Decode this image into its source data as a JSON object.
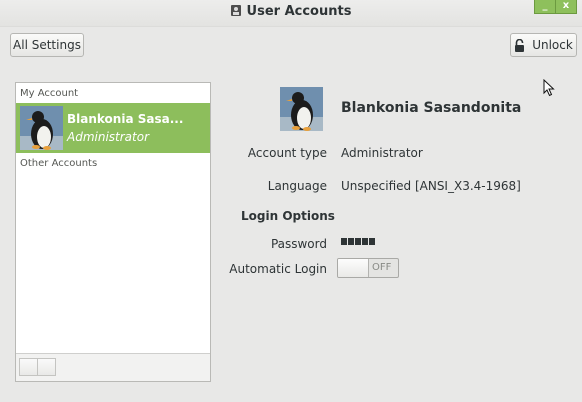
{
  "window": {
    "title": "User Accounts",
    "buttons": [
      "_",
      "x"
    ]
  },
  "toolbar": {
    "all_settings_label": "All Settings",
    "unlock_label": "Unlock"
  },
  "accounts": {
    "my_account_header": "My Account",
    "other_accounts_header": "Other Accounts",
    "selected_account": {
      "name": "Blankonia Sasa...",
      "role": "Administrator"
    }
  },
  "details": {
    "full_name": "Blankonia Sasandonita",
    "account_type_label": "Account type",
    "account_type_value": "Administrator",
    "language_label": "Language",
    "language_value": "Unspecified [ANSI_X3.4-1968]",
    "login_options_header": "Login Options",
    "password_label": "Password",
    "password_value": "●●●●●",
    "automatic_login_label": "Automatic Login",
    "automatic_login_state": "OFF"
  },
  "colors": {
    "selection": "#8dbe5c",
    "window_bg": "#e8e8e7",
    "close_button": "#8ec05c"
  }
}
